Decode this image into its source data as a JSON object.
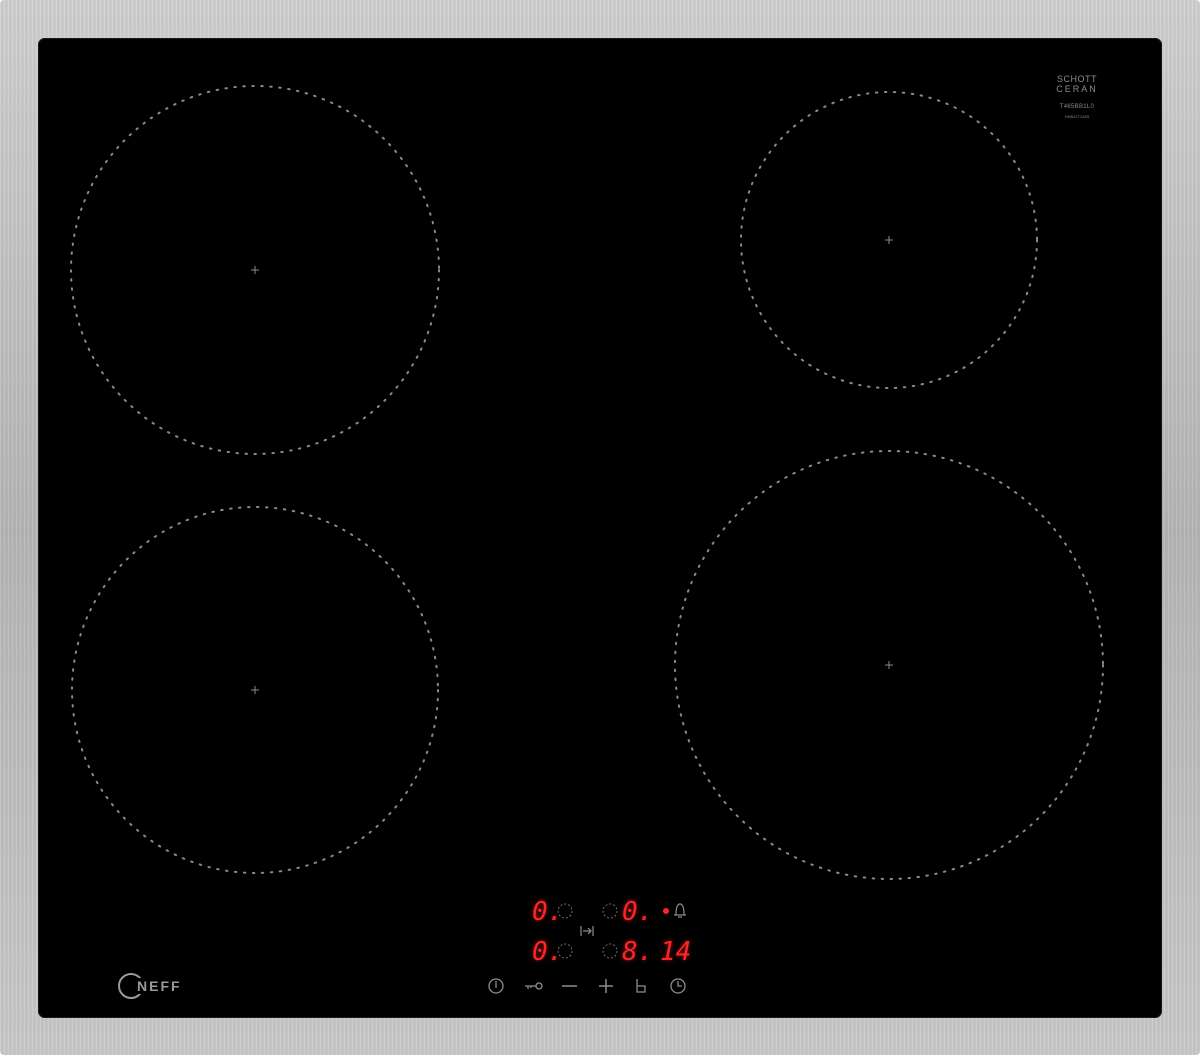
{
  "appliance": {
    "glass_logo": {
      "line1": "SCHOTT",
      "line2": "CERAN",
      "line3": "T465BB1L0",
      "line4": "HHB1271A25"
    },
    "brand": "NEFF"
  },
  "displays": {
    "top_left": "0.",
    "top_right": "0.",
    "bottom_left": "0.",
    "bottom_right": "8.",
    "timer": "14"
  },
  "controls": {
    "power_icon": "power-icon",
    "lock_icon": "key-lock-icon",
    "minus_icon": "minus-icon",
    "plus_icon": "plus-icon",
    "timer_icon": "clock-icon",
    "alarm_icon": "bell-icon"
  },
  "colors": {
    "display_red": "#ff2424",
    "glass": "#000000",
    "frame": "#bdbdbd"
  }
}
